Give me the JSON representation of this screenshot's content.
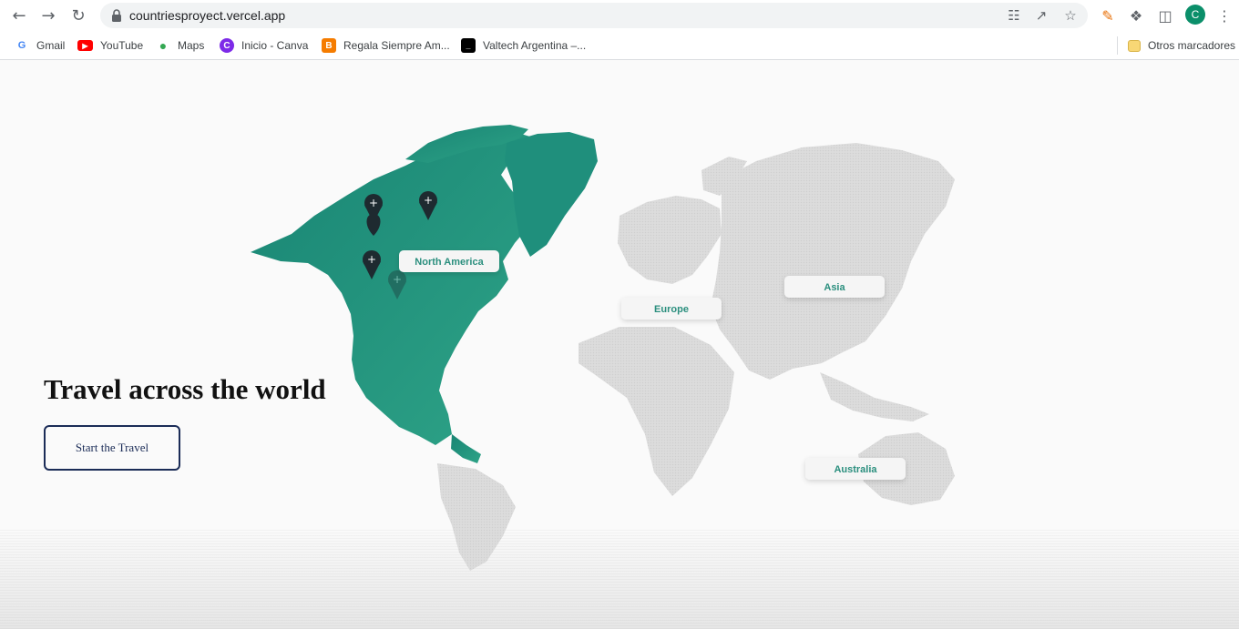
{
  "browser": {
    "url": "countriesproyect.vercel.app",
    "avatar_letter": "C",
    "bookmarks": [
      {
        "label": "Gmail",
        "icon": "google-icon",
        "color": "#4285f4"
      },
      {
        "label": "YouTube",
        "icon": "youtube-icon",
        "color": "#ff0000"
      },
      {
        "label": "Maps",
        "icon": "maps-icon",
        "color": "#34a853"
      },
      {
        "label": "Inicio - Canva",
        "icon": "canva-icon",
        "color": "#7d2ae8"
      },
      {
        "label": "Regala Siempre Am...",
        "icon": "blogger-icon",
        "color": "#f57c00"
      },
      {
        "label": "Valtech Argentina –...",
        "icon": "valtech-icon",
        "color": "#000000"
      }
    ],
    "other_bookmarks": "Otros marcadores"
  },
  "map": {
    "regions": [
      {
        "label": "North America",
        "active": true
      },
      {
        "label": "Europe",
        "active": false
      },
      {
        "label": "Asia",
        "active": false
      },
      {
        "label": "Australia",
        "active": false
      }
    ],
    "active_color": "#1f8f7c",
    "inactive_color": "#d9d9d9"
  },
  "hero": {
    "title": "Travel across the world",
    "cta_label": "Start the Travel"
  }
}
